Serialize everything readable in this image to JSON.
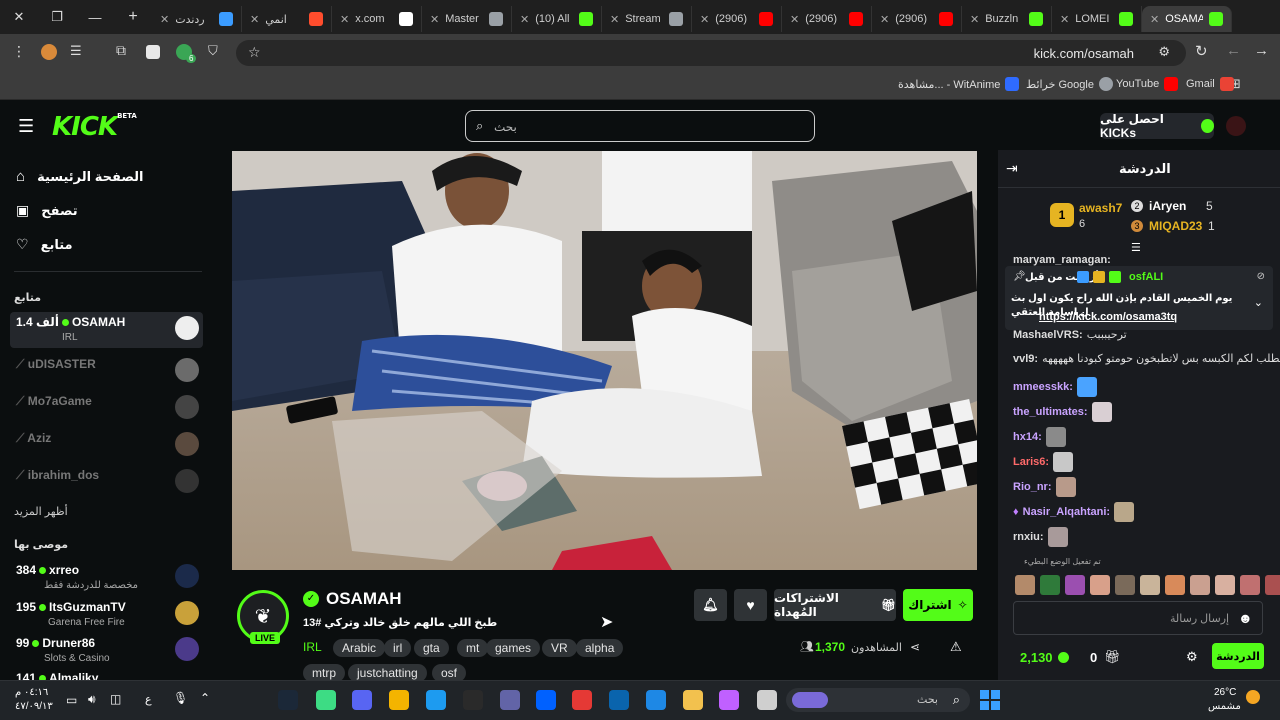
{
  "browser": {
    "tabs": [
      {
        "label": "ردندت",
        "fav": "#3b9cff"
      },
      {
        "label": "انمي",
        "fav": "#ff4d2d"
      },
      {
        "label": "x.com",
        "fav": "#ffffff"
      },
      {
        "label": "Master",
        "fav": "#9aa0a6"
      },
      {
        "label": "(10) All",
        "fav": "#53fc18"
      },
      {
        "label": "Stream",
        "fav": "#9aa0a6"
      },
      {
        "label": "(2906)",
        "fav": "#ff0000"
      },
      {
        "label": "(2906)",
        "fav": "#ff0000"
      },
      {
        "label": "(2906)",
        "fav": "#ff0000"
      },
      {
        "label": "Buzzln",
        "fav": "#53fc18"
      },
      {
        "label": "LOMEI",
        "fav": "#53fc18"
      },
      {
        "label": "OSAMA",
        "fav": "#53fc18"
      }
    ],
    "url": "kick.com/osamah",
    "extension_badge": "6",
    "bookmarks": [
      {
        "label": "Gmail",
        "color": "#ea4335"
      },
      {
        "label": "YouTube",
        "color": "#ff0000"
      },
      {
        "label": "خرائط Google",
        "color": "#9aa0a6"
      },
      {
        "label": "مشاهدة... - WitAnime",
        "color": "#2f6bff"
      }
    ]
  },
  "header": {
    "logo": "KICK",
    "logo_badge": "BETA",
    "search_placeholder": "بحث",
    "get_kicks": "احصل على KICKs"
  },
  "sidebar": {
    "nav": [
      {
        "label": "الصفحة الرئيسية",
        "icon": "home-icon"
      },
      {
        "label": "تصفح",
        "icon": "browse-icon"
      },
      {
        "label": "متابع",
        "icon": "heart-icon"
      }
    ],
    "following_title": "متابع",
    "following": [
      {
        "name": "OSAMAH",
        "viewers": "1.4 ألف",
        "category": "IRL",
        "live": true
      },
      {
        "name": "uDISASTER",
        "live": false
      },
      {
        "name": "Mo7aGame",
        "live": false
      },
      {
        "name": "Aziz",
        "live": false
      },
      {
        "name": "ibrahim_dos",
        "live": false
      }
    ],
    "show_more": "أظهر المزيد",
    "recommended_title": "موصى بها",
    "recommended": [
      {
        "name": "xrreo",
        "viewers": "384",
        "category": "مخصصة للدردشة فقط"
      },
      {
        "name": "ItsGuzmanTV",
        "viewers": "195",
        "category": "Garena Free Fire"
      },
      {
        "name": "Druner86",
        "viewers": "99",
        "category": "Slots & Casino"
      },
      {
        "name": "Almaliky",
        "viewers": "141",
        "category": ""
      }
    ]
  },
  "stream": {
    "channel": "OSAMAH",
    "title": "طبخ اللي مالهم خلق خالد وتركي #13",
    "live_badge": "LIVE",
    "category": "IRL",
    "tags": [
      "Arabic",
      "irl",
      "gta",
      "mt",
      "games",
      "VR",
      "alpha",
      "mtrp",
      "justchatting",
      "osf"
    ],
    "subscribe_label": "اشتراك",
    "gift_label": "الاشتراكات المُهداة",
    "viewers_label": "المشاهدون",
    "viewers_count": "1,370"
  },
  "chat": {
    "title": "الدردشة",
    "leaderboard": [
      {
        "rank": "1",
        "name": "awash7",
        "value": "6"
      },
      {
        "rank": "2",
        "name": "iAryen",
        "value": "5"
      },
      {
        "rank": "3",
        "name": "MIQAD23",
        "value": "1"
      }
    ],
    "pinned": {
      "pinned_by_label": "أرسلت من قبل",
      "pinned_by": "osfALI",
      "text": "يوم الخميس القادم بإذن الله راح يكون اول بث ل اسامة العتقي",
      "link": "https://kick.com/osama3tq"
    },
    "messages": [
      {
        "user": "maryam_ramagan:",
        "text": "",
        "color": "#dddddd"
      },
      {
        "user": "MashaelVRS:",
        "text": "ترحيبببب",
        "color": "#dddddd"
      },
      {
        "user": "vvl9:",
        "text": "يطلب لكم الكبسه بس لاتطبخون حومتو كبودنا هههههه",
        "color": "#dddddd"
      },
      {
        "user": "mmeesskk:",
        "text": "",
        "color": "#c9a3ff"
      },
      {
        "user": "the_ultimates:",
        "text": "",
        "color": "#c9a3ff"
      },
      {
        "user": "hx14:",
        "text": "",
        "color": "#c9a3ff"
      },
      {
        "user": "Laris6:",
        "text": "",
        "color": "#ff6a6a"
      },
      {
        "user": "Rio_nr:",
        "text": "",
        "color": "#c9a3ff"
      },
      {
        "user": "Nasir_Alqahtani:",
        "text": "",
        "color": "#c9a3ff"
      },
      {
        "user": "rnxiu:",
        "text": "",
        "color": "#dddddd"
      }
    ],
    "slow_mode_note": "تم تفعيل الوضع البطيء",
    "input_placeholder": "إرسال رسالة",
    "kicks_balance": "2,130",
    "gift_count": "0",
    "send_label": "الدردشة"
  },
  "taskbar": {
    "search_placeholder": "بحث",
    "weather_temp": "26°C",
    "weather_desc": "مشمس",
    "time": "٠٤:١٦ م",
    "date": "٤٧/٠٩/١٣",
    "lang": "ع"
  }
}
